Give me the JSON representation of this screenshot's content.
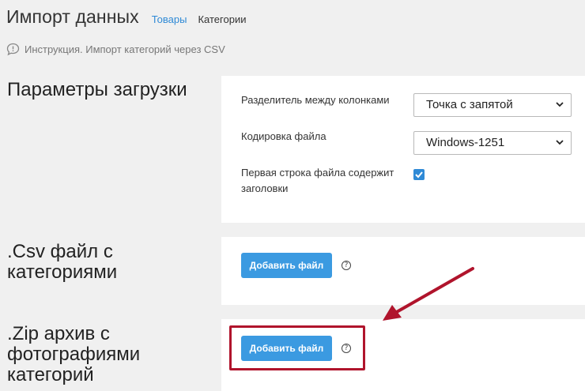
{
  "header": {
    "title": "Импорт данных",
    "tabs": [
      {
        "label": "Товары",
        "active": true
      },
      {
        "label": "Категории",
        "active": false
      }
    ],
    "help_link": "Инструкция. Импорт категорий через CSV"
  },
  "sections": {
    "params": {
      "title": "Параметры загрузки",
      "separator_label": "Разделитель между колонками",
      "separator_value": "Точка с запятой",
      "encoding_label": "Кодировка файла",
      "encoding_value": "Windows-1251",
      "header_row_label_line1": "Первая строка файла содержит",
      "header_row_label_line2": "заголовки",
      "header_row_checked": true
    },
    "csv": {
      "title_line1": ".Csv файл с",
      "title_line2": "категориями",
      "button": "Добавить файл",
      "help": "?"
    },
    "zip": {
      "title_line1": ".Zip архив с",
      "title_line2": "фотографиями",
      "title_line3": "категорий",
      "button": "Добавить файл",
      "help": "?"
    }
  },
  "colors": {
    "accent": "#3b9ae1",
    "link": "#2f8ad6",
    "annotation": "#b0142c",
    "background": "#f0f0f0"
  },
  "icons": [
    "comment-icon",
    "chevron-down-icon",
    "checkmark-icon",
    "question-icon",
    "arrow-annotation"
  ]
}
